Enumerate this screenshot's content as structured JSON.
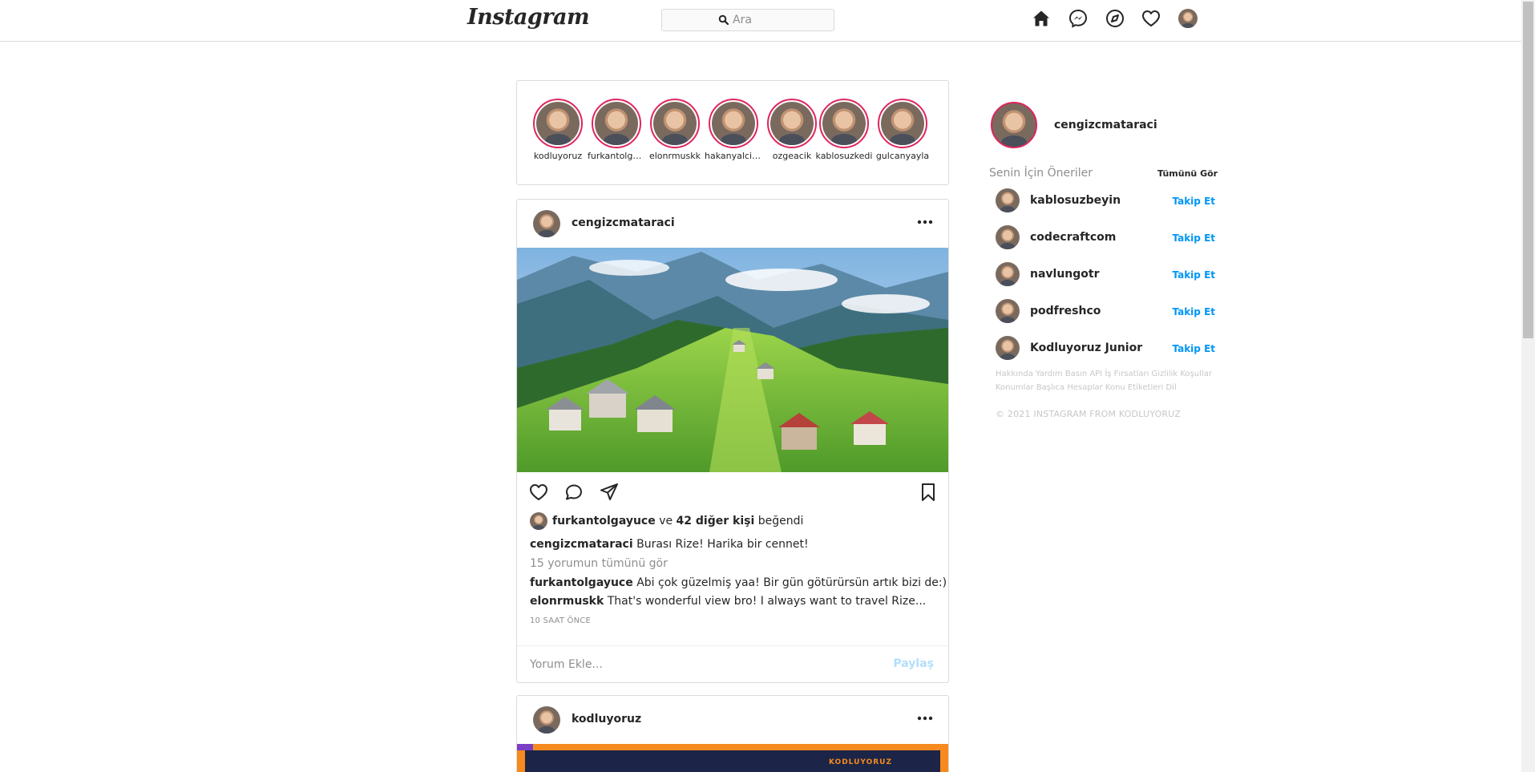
{
  "header": {
    "logo": "Instagram",
    "search_placeholder": "Ara",
    "icons": [
      "home-icon",
      "messenger-icon",
      "explore-icon",
      "heart-icon",
      "profile-avatar"
    ]
  },
  "stories": [
    {
      "username": "kodluyoruz"
    },
    {
      "username": "furkantolga..."
    },
    {
      "username": "elonrmuskk"
    },
    {
      "username": "hakanyalcin..."
    },
    {
      "username": "ozgeacik"
    },
    {
      "username": "kablosuzkedi"
    },
    {
      "username": "gulcanyayla"
    }
  ],
  "post": {
    "username": "cengizcmataraci",
    "liked_by_user": "furkantolgayuce",
    "liked_connector": "ve",
    "liked_others": "42 diğer kişi",
    "liked_suffix": "beğendi",
    "caption_user": "cengizcmataraci",
    "caption_text": "Burası Rize! Harika bir cennet!",
    "view_comments": "15 yorumun tümünü gör",
    "comments": [
      {
        "user": "furkantolgayuce",
        "text": "Abi çok güzelmiş yaa! Bir gün götürürsün artık bizi de:)"
      },
      {
        "user": "elonrmuskk",
        "text": "That's wonderful view bro! I always want to travel Rize..."
      }
    ],
    "time_ago": "10 SAAT ÖNCE",
    "comment_placeholder": "Yorum Ekle...",
    "share_label": "Paylaş"
  },
  "post2": {
    "username": "kodluyoruz",
    "image_brand": "KODLUYORUZ"
  },
  "sidebar": {
    "username": "cengizcmataraci",
    "suggestions_title": "Senin İçin Öneriler",
    "see_all": "Tümünü Gör",
    "suggestions": [
      {
        "name": "kablosuzbeyin",
        "action": "Takip Et"
      },
      {
        "name": "codecraftcom",
        "action": "Takip Et"
      },
      {
        "name": "navlungotr",
        "action": "Takip Et"
      },
      {
        "name": "podfreshco",
        "action": "Takip Et"
      },
      {
        "name": "Kodluyoruz Junior",
        "action": "Takip Et"
      }
    ],
    "footer_links": "Hakkında Yardım Basın API İş Fırsatları Gizlilik Koşullar Konumlar Başlıca Hesaplar Konu Etiketleri Dil",
    "copyright": "© 2021 INSTAGRAM FROM KODLUYORUZ"
  },
  "colors": {
    "accent_blue": "#0095f6",
    "story_ring": "#e0245e",
    "border": "#dbdbdb",
    "muted": "#8e8e8e"
  }
}
